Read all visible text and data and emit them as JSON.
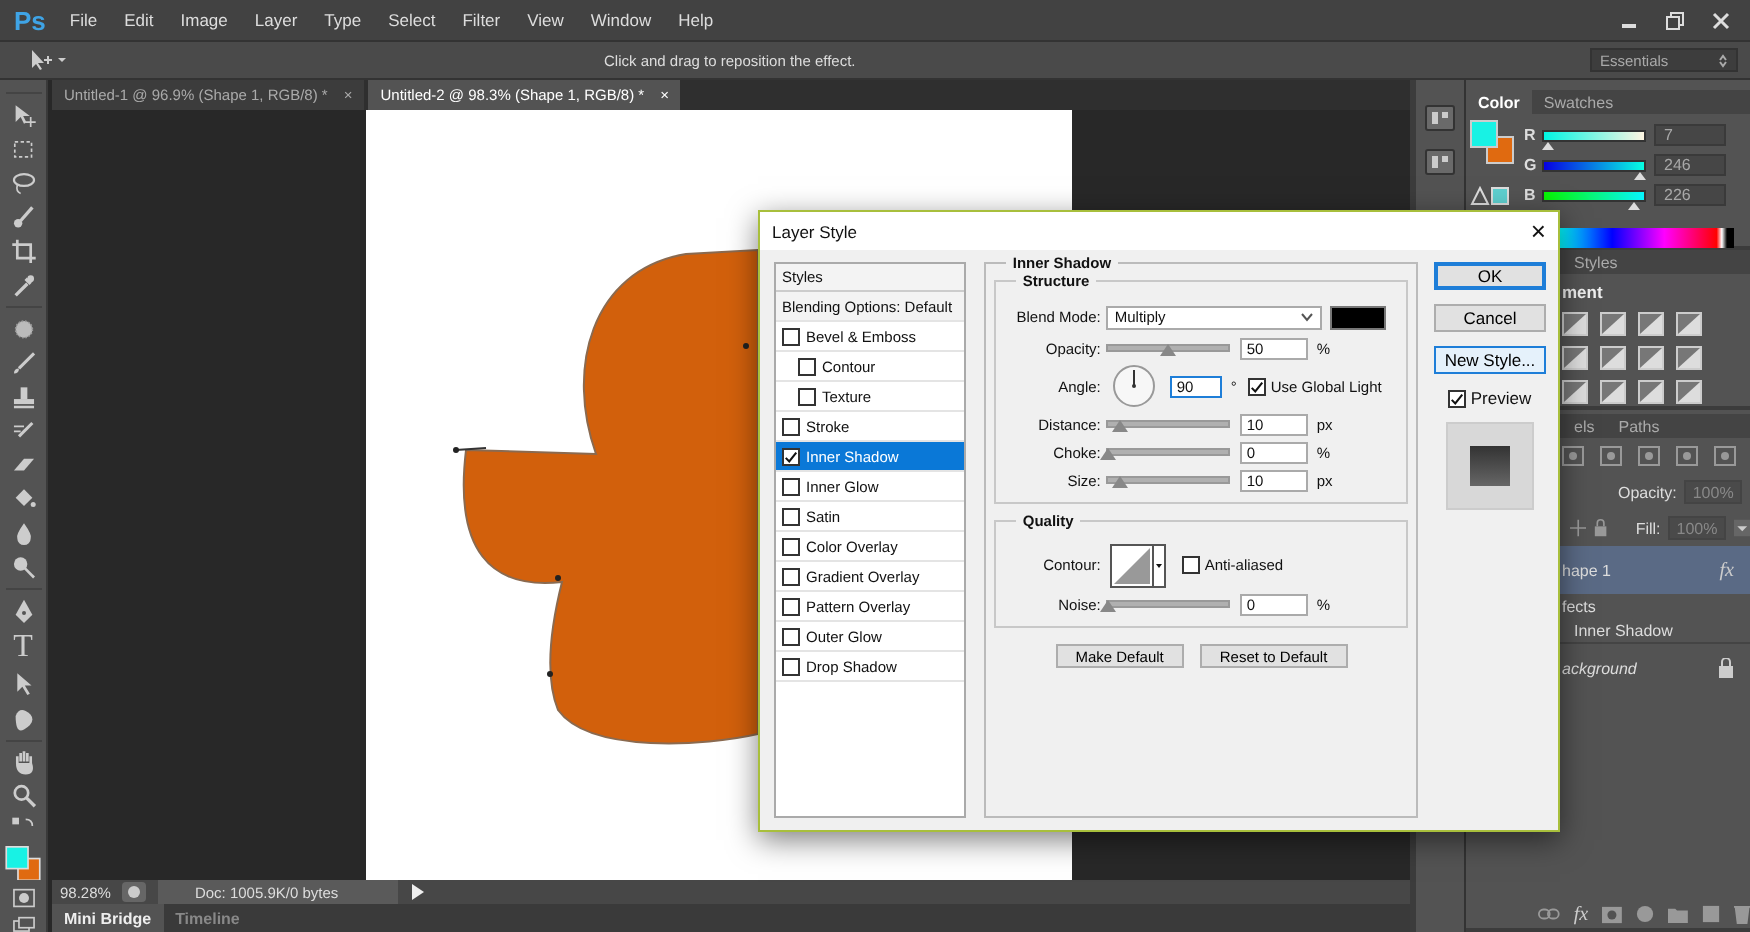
{
  "app": {
    "logo": "Ps",
    "menu": [
      "File",
      "Edit",
      "Image",
      "Layer",
      "Type",
      "Select",
      "Filter",
      "View",
      "Window",
      "Help"
    ]
  },
  "options_bar": {
    "hint": "Click and drag to reposition the effect.",
    "workspace": "Essentials"
  },
  "document_tabs": [
    {
      "label": "Untitled-1 @ 96.9% (Shape 1, RGB/8) *",
      "close": "×",
      "selected": false
    },
    {
      "label": "Untitled-2 @ 98.3% (Shape 1, RGB/8) *",
      "close": "×",
      "selected": true
    }
  ],
  "toolbar": {
    "type_glyph": "T"
  },
  "status_bar": {
    "zoom": "98.28%",
    "doc": "Doc: 1005.9K/0 bytes"
  },
  "bottom_tabs": [
    {
      "label": "Mini Bridge",
      "selected": true
    },
    {
      "label": "Timeline",
      "selected": false
    }
  ],
  "color_panel": {
    "tabs": [
      {
        "label": "Color",
        "selected": true
      },
      {
        "label": "Swatches",
        "selected": false
      }
    ],
    "channels": [
      {
        "name": "R",
        "level": 0.03,
        "value": "7"
      },
      {
        "name": "G",
        "level": 0.96,
        "value": "246"
      },
      {
        "name": "B",
        "level": 0.89,
        "value": "226"
      }
    ]
  },
  "styles_panel": {
    "tabs": [
      {
        "label": "Styles",
        "selected": false
      }
    ],
    "heading": "ment"
  },
  "layers_panel": {
    "tabs": [
      {
        "label": "els",
        "selected": false
      },
      {
        "label": "Paths",
        "selected": false
      }
    ],
    "opacity_label": "Opacity:",
    "opacity": "100%",
    "fill_label": "Fill:",
    "fill": "100%",
    "layers": [
      {
        "kind": "layer",
        "name": "hape 1",
        "badge": "fx",
        "selected": true
      },
      {
        "kind": "effects",
        "name": "fects",
        "selected": false
      },
      {
        "kind": "effect",
        "name": "Inner Shadow",
        "selected": false
      },
      {
        "kind": "background",
        "name": "ackground",
        "selected": false
      }
    ],
    "footer_fx": "fx"
  },
  "dialog": {
    "title": "Layer Style",
    "close": "×",
    "styles_header": "Styles",
    "styles": [
      {
        "kind": "header",
        "label": "Blending Options: Default",
        "selected": false
      },
      {
        "kind": "check",
        "label": "Bevel & Emboss",
        "checked": false,
        "selected": false
      },
      {
        "kind": "subcheck",
        "label": "Contour",
        "checked": false,
        "selected": false
      },
      {
        "kind": "subcheck",
        "label": "Texture",
        "checked": false,
        "selected": false
      },
      {
        "kind": "check",
        "label": "Stroke",
        "checked": false,
        "selected": false
      },
      {
        "kind": "check",
        "label": "Inner Shadow",
        "checked": true,
        "selected": true
      },
      {
        "kind": "check",
        "label": "Inner Glow",
        "checked": false,
        "selected": false
      },
      {
        "kind": "check",
        "label": "Satin",
        "checked": false,
        "selected": false
      },
      {
        "kind": "check",
        "label": "Color Overlay",
        "checked": false,
        "selected": false
      },
      {
        "kind": "check",
        "label": "Gradient Overlay",
        "checked": false,
        "selected": false
      },
      {
        "kind": "check",
        "label": "Pattern Overlay",
        "checked": false,
        "selected": false
      },
      {
        "kind": "check",
        "label": "Outer Glow",
        "checked": false,
        "selected": false
      },
      {
        "kind": "check",
        "label": "Drop Shadow",
        "checked": false,
        "selected": false
      }
    ],
    "section_title": "Inner Shadow",
    "structure": {
      "title": "Structure",
      "blend_mode_label": "Blend Mode:",
      "blend_mode": "Multiply",
      "color": "#000000",
      "rows": [
        {
          "kind": "slider",
          "label": "Opacity:",
          "level": 0.5,
          "value": "50",
          "unit": "%"
        },
        {
          "kind": "angle",
          "label": "Angle:",
          "value": "90",
          "unit": "°",
          "focused": true,
          "global_light": {
            "label": "Use Global Light",
            "checked": true
          }
        },
        {
          "kind": "slider",
          "label": "Distance:",
          "level": 0.1,
          "value": "10",
          "unit": "px"
        },
        {
          "kind": "slider",
          "label": "Choke:",
          "level": 0,
          "value": "0",
          "unit": "%"
        },
        {
          "kind": "slider",
          "label": "Size:",
          "level": 0.1,
          "value": "10",
          "unit": "px"
        }
      ]
    },
    "quality": {
      "title": "Quality",
      "contour_label": "Contour:",
      "anti_aliased": {
        "label": "Anti-aliased",
        "checked": false
      },
      "noise": {
        "label": "Noise:",
        "level": 0,
        "value": "0",
        "unit": "%"
      }
    },
    "buttons": [
      "Make Default",
      "Reset to Default"
    ],
    "side_buttons": [
      {
        "label": "OK",
        "kind": "default"
      },
      {
        "label": "Cancel",
        "kind": "normal"
      },
      {
        "label": "New Style...",
        "kind": "focused"
      }
    ],
    "preview": {
      "label": "Preview",
      "checked": true
    }
  }
}
